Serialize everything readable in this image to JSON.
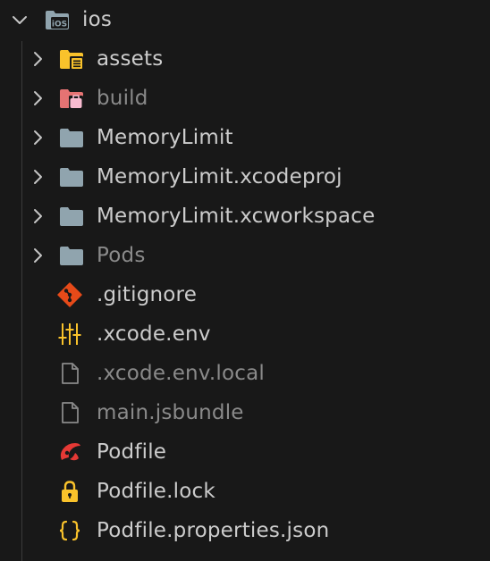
{
  "root": {
    "label": "ios",
    "badge": "iOS"
  },
  "items": [
    {
      "label": "assets"
    },
    {
      "label": "build"
    },
    {
      "label": "MemoryLimit"
    },
    {
      "label": "MemoryLimit.xcodeproj"
    },
    {
      "label": "MemoryLimit.xcworkspace"
    },
    {
      "label": "Pods"
    },
    {
      "label": ".gitignore"
    },
    {
      "label": ".xcode.env"
    },
    {
      "label": ".xcode.env.local"
    },
    {
      "label": "main.jsbundle"
    },
    {
      "label": "Podfile"
    },
    {
      "label": "Podfile.lock"
    },
    {
      "label": "Podfile.properties.json"
    }
  ],
  "colors": {
    "background": "#181818",
    "text": "#cccccc",
    "text_dimmed": "#8a8a8a",
    "folder": "#90a4ae",
    "assets_folder": "#f9c22b",
    "build_folder": "#e57373",
    "git": "#e64a19",
    "lock": "#f9c22b",
    "json_braces": "#f9c22b"
  }
}
